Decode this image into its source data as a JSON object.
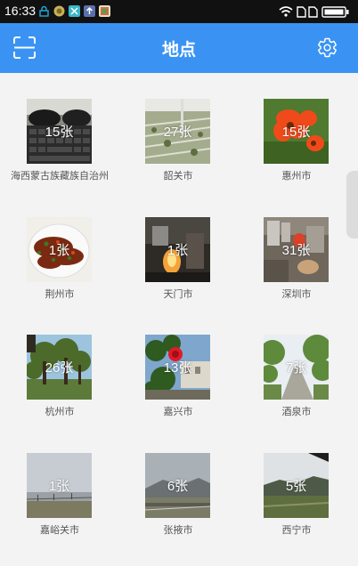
{
  "statusbar": {
    "time": "16:33"
  },
  "appbar": {
    "title": "地点"
  },
  "locations": [
    {
      "label": "海西蒙古族藏族自治州",
      "count": "15张"
    },
    {
      "label": "韶关市",
      "count": "27张"
    },
    {
      "label": "惠州市",
      "count": "15张"
    },
    {
      "label": "荆州市",
      "count": "1张"
    },
    {
      "label": "天门市",
      "count": "1张"
    },
    {
      "label": "深圳市",
      "count": "31张"
    },
    {
      "label": "杭州市",
      "count": "26张"
    },
    {
      "label": "嘉兴市",
      "count": "13张"
    },
    {
      "label": "酒泉市",
      "count": "7张"
    },
    {
      "label": "嘉峪关市",
      "count": "1张"
    },
    {
      "label": "张掖市",
      "count": "6张"
    },
    {
      "label": "西宁市",
      "count": "5张"
    }
  ],
  "colors": {
    "appbar": "#3a93f2",
    "statusbar": "#111111",
    "background": "#f3f3f3"
  }
}
